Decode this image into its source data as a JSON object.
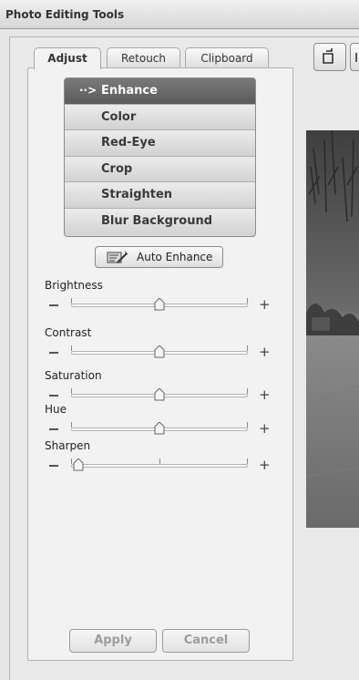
{
  "window": {
    "title": "Photo Editing Tools"
  },
  "tabs": [
    {
      "label": "Adjust",
      "active": true
    },
    {
      "label": "Retouch",
      "active": false
    },
    {
      "label": "Clipboard",
      "active": false
    }
  ],
  "adjust_menu": {
    "items": [
      {
        "label": "Enhance",
        "selected": true
      },
      {
        "label": "Color",
        "selected": false
      },
      {
        "label": "Red-Eye",
        "selected": false
      },
      {
        "label": "Crop",
        "selected": false
      },
      {
        "label": "Straighten",
        "selected": false
      },
      {
        "label": "Blur Background",
        "selected": false
      }
    ],
    "selected_marker": "··>"
  },
  "auto_enhance": {
    "label": "Auto Enhance",
    "icon": "auto-enhance-icon"
  },
  "sliders": [
    {
      "label": "Brightness",
      "value": 0.5
    },
    {
      "label": "Contrast",
      "value": 0.5
    },
    {
      "label": "Saturation",
      "value": 0.5
    },
    {
      "label": "Hue",
      "value": 0.5
    },
    {
      "label": "Sharpen",
      "value": 0.0
    }
  ],
  "slider_symbols": {
    "minus": "–",
    "plus": "+"
  },
  "buttons": {
    "apply": "Apply",
    "cancel": "Cancel"
  },
  "toolbar": {
    "icons": [
      "rotate-left-icon",
      "rotate-right-icon"
    ]
  },
  "colors": {
    "selected_item": "#666666",
    "background": "#e6e6e6"
  }
}
